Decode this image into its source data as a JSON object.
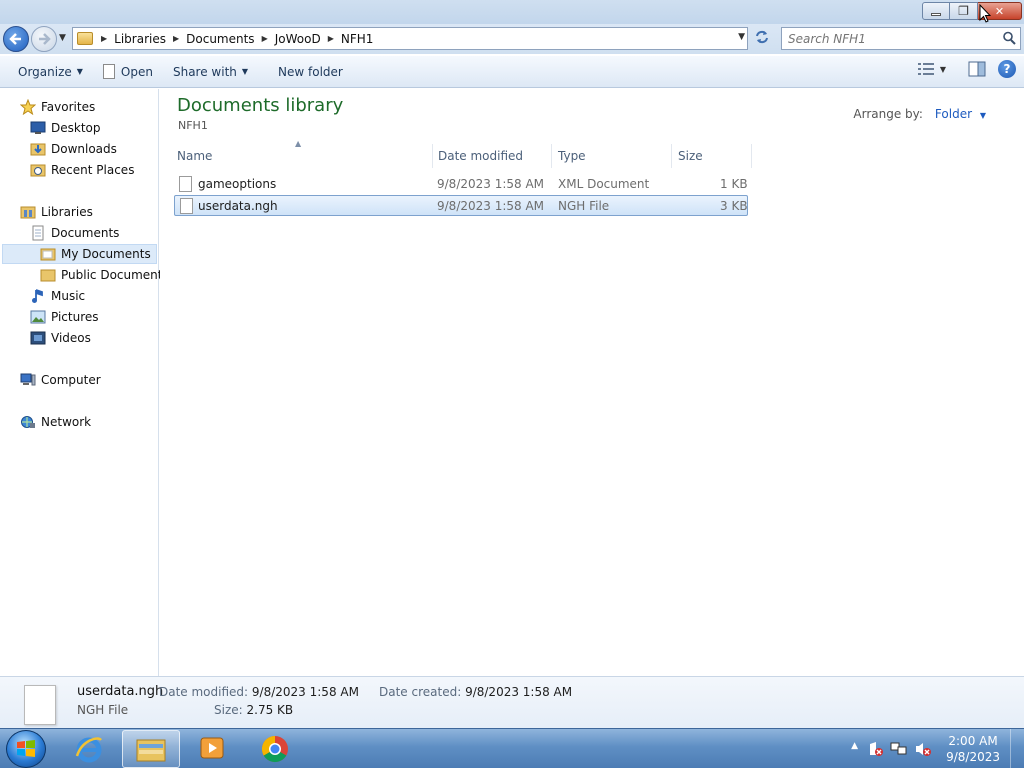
{
  "window": {
    "minimize_glyph": "▭",
    "restore_glyph": "❐",
    "close_glyph": "✕"
  },
  "address": {
    "crumbs": [
      "Libraries",
      "Documents",
      "JoWooD",
      "NFH1"
    ],
    "search_placeholder": "Search NFH1"
  },
  "toolbar": {
    "organize": "Organize",
    "open": "Open",
    "share_with": "Share with",
    "new_folder": "New folder"
  },
  "nav": {
    "favorites": "Favorites",
    "desktop": "Desktop",
    "downloads": "Downloads",
    "recent_places": "Recent Places",
    "libraries": "Libraries",
    "documents": "Documents",
    "my_documents": "My Documents",
    "public_documents": "Public Documents",
    "music": "Music",
    "pictures": "Pictures",
    "videos": "Videos",
    "computer": "Computer",
    "network": "Network"
  },
  "library": {
    "title": "Documents library",
    "subtitle": "NFH1",
    "arrange_label": "Arrange by:",
    "arrange_value": "Folder"
  },
  "columns": {
    "name": "Name",
    "date_modified": "Date modified",
    "type": "Type",
    "size": "Size"
  },
  "files": [
    {
      "name": "gameoptions",
      "date": "9/8/2023 1:58 AM",
      "type": "XML Document",
      "size": "1 KB",
      "selected": false
    },
    {
      "name": "userdata.ngh",
      "date": "9/8/2023 1:58 AM",
      "type": "NGH File",
      "size": "3 KB",
      "selected": true
    }
  ],
  "details": {
    "name": "userdata.ngh",
    "type": "NGH File",
    "date_modified_label": "Date modified:",
    "date_modified": "9/8/2023 1:58 AM",
    "date_created_label": "Date created:",
    "date_created": "9/8/2023 1:58 AM",
    "size_label": "Size:",
    "size": "2.75 KB"
  },
  "clock": {
    "time": "2:00 AM",
    "date": "9/8/2023"
  }
}
